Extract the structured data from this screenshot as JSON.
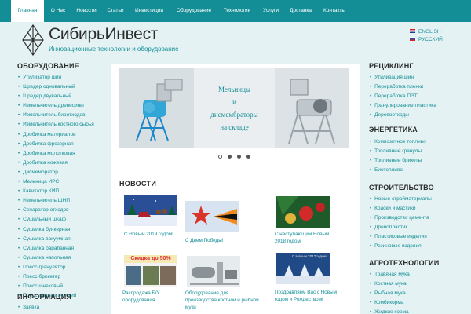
{
  "nav": {
    "items": [
      {
        "label": "Главная",
        "active": true
      },
      {
        "label": "О Нас"
      },
      {
        "label": "Новости"
      },
      {
        "label": "Статьи"
      },
      {
        "label": "Инвестиции"
      },
      {
        "label": "Оборудование"
      },
      {
        "label": "Технологии"
      },
      {
        "label": "Услуги"
      },
      {
        "label": "Доставка"
      },
      {
        "label": "Контакты"
      }
    ]
  },
  "header": {
    "logo_text": "СибирьИнвест",
    "tagline": "Инновационные технологии и оборудование"
  },
  "lang": {
    "english": "ENGLISH",
    "russian": "РУССКИЙ"
  },
  "left": {
    "equipment_title": "ОБОРУДОВАНИЕ",
    "equipment_items": [
      "Утилизатор шин",
      "Шредер одновальный",
      "Шредер двувальный",
      "Измельчитель древесины",
      "Измельчитель биоотходов",
      "Измельчитель костного сырья",
      "Дробилка материалов",
      "Дробилка фрезерная",
      "Дробилка молотковая",
      "Дробилка ножевая",
      "Дисмембратор",
      "Мельница ИРС",
      "Кавитатор КИП",
      "Измельчитель ШНП",
      "Сепаратор отходов",
      "Сушильный шкаф",
      "Сушилка бункерная",
      "Сушилка вакуумная",
      "Сушилка барабанная",
      "Сушилка напольная",
      "Пресс-гранулятор",
      "Пресс-брикетер",
      "Пресс шнековый",
      "Пресс гидравлический"
    ],
    "info_title": "ИНФОРМАЦИЯ",
    "info_items": [
      "Заявка"
    ]
  },
  "slider": {
    "line1": "Мельницы",
    "line2": "и",
    "line3": "дисмембраторы",
    "line4": "на складе"
  },
  "news": {
    "title": "НОВОСТИ",
    "items": [
      {
        "caption": "С Новым 2019 годом!"
      },
      {
        "caption": "С Днем Победы!"
      },
      {
        "caption": "С наступающим Новым 2018 годом"
      },
      {
        "caption": "Распродажа Б/У оборудования",
        "thumb_text": "Скидка до 50%"
      },
      {
        "caption": "Оборудование для производства костной и рыбной муки"
      },
      {
        "caption": "Поздравляем Вас с Новым годом и Рождеством!",
        "thumb_text": "С Новым 2017 годом!"
      }
    ]
  },
  "right": {
    "sections": [
      {
        "title": "РЕЦИКЛИНГ",
        "items": [
          "Утилизация шин",
          "Переработка пленки",
          "Переработка ПЭТ",
          "Гранулирование пластика",
          "Деревоотходы"
        ]
      },
      {
        "title": "ЭНЕРГЕТИКА",
        "items": [
          "Композитное топливо",
          "Топливные гранулы",
          "Топливные брикеты",
          "Биотопливо"
        ]
      },
      {
        "title": "СТРОИТЕЛЬСТВО",
        "items": [
          "Новые стройматериалы",
          "Краски и мастики",
          "Производство цемента",
          "Древопластик",
          "Пластиковые изделия",
          "Резиновые изделия"
        ]
      },
      {
        "title": "АГРОТЕХНОЛОГИИ",
        "items": [
          "Травяная мука",
          "Костная мука",
          "Рыбная мука",
          "Комбикорма",
          "Жидкие корма"
        ]
      }
    ]
  },
  "colors": {
    "brand_teal": "#138e96",
    "page_bg": "#e4f2f3"
  }
}
